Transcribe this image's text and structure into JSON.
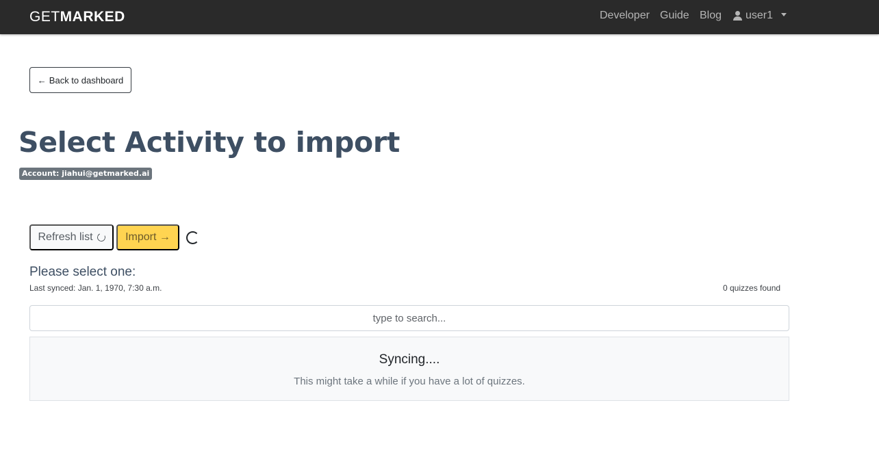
{
  "navbar": {
    "brand_light": "GET",
    "brand_bold": "MARKED",
    "links": {
      "developer": "Developer",
      "guide": "Guide",
      "blog": "Blog"
    },
    "user": "user1"
  },
  "back_button": {
    "arrow": "←",
    "label": "Back to dashboard"
  },
  "page": {
    "title": "Select Activity to import",
    "account_badge": "Account: jiahui@getmarked.ai"
  },
  "actions": {
    "refresh_label": "Refresh list",
    "import_label": "Import →"
  },
  "list": {
    "heading": "Please select one:",
    "last_synced": "Last synced: Jan. 1, 1970, 7:30 a.m.",
    "count": "0 quizzes found",
    "search_placeholder": "type to search..."
  },
  "sync": {
    "title": "Syncing....",
    "subtitle": "This might take a while if you have a lot of quizzes."
  },
  "colors": {
    "navbar": "#2a2a2a",
    "title": "#3e4f63",
    "import": "#ffd451",
    "badge": "#6c757d"
  }
}
